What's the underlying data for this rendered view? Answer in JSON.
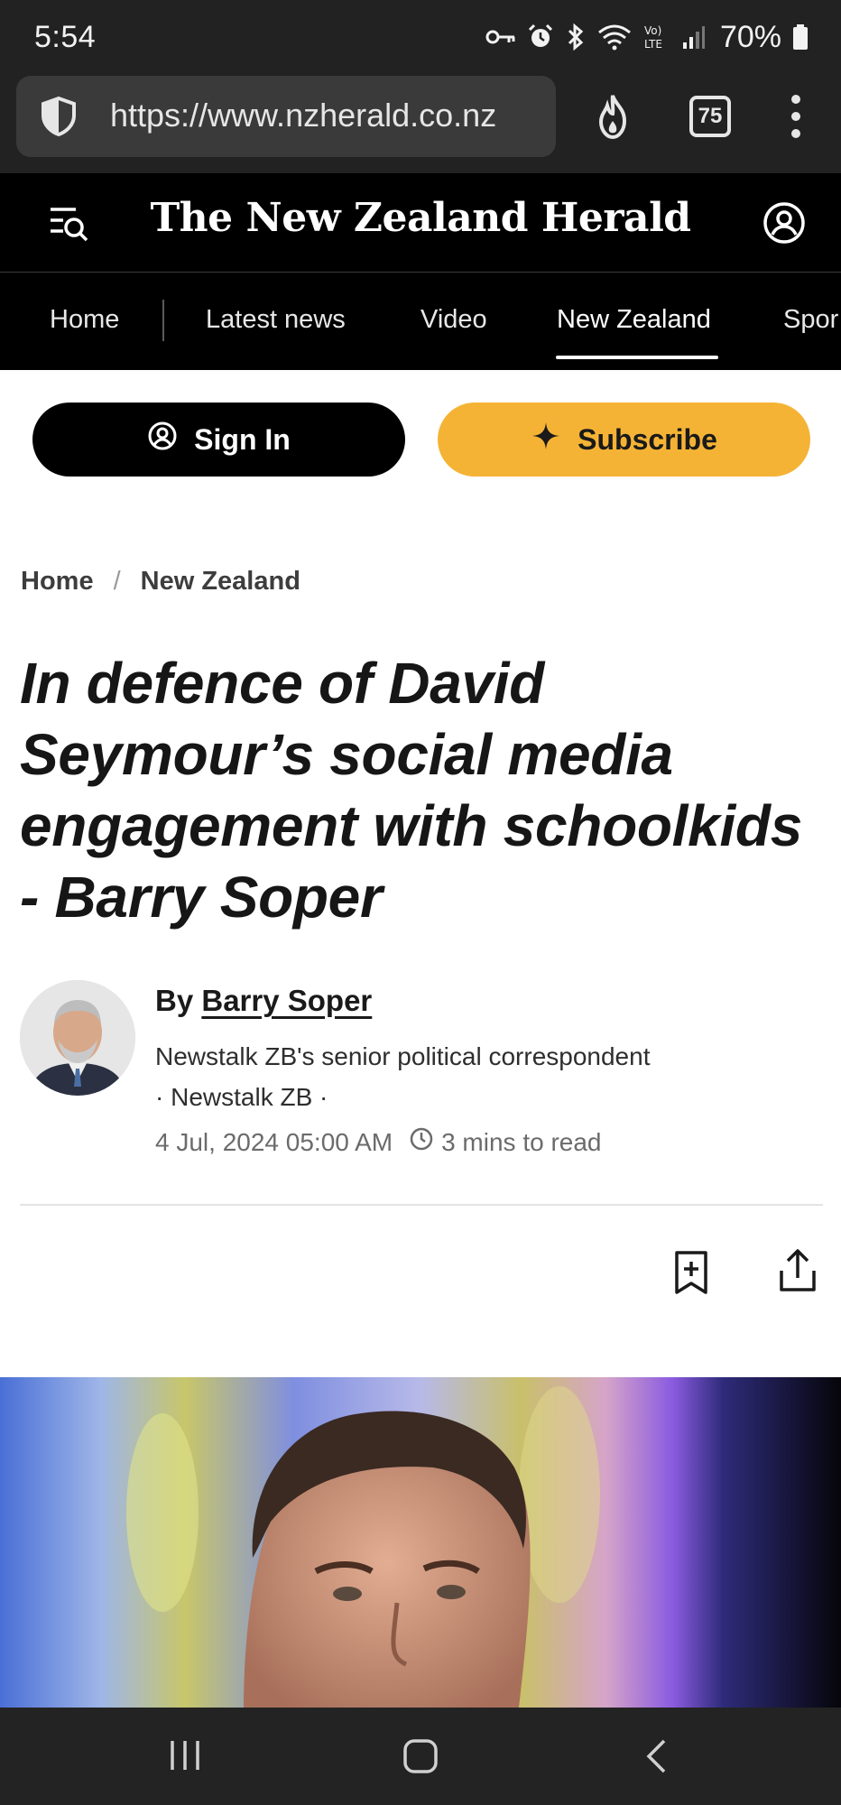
{
  "status_bar": {
    "time": "5:54",
    "battery": "70%"
  },
  "browser": {
    "url": "https://www.nzherald.co.nz",
    "tab_count": "75"
  },
  "site": {
    "masthead": "The New Zealand Herald"
  },
  "nav": {
    "items": [
      {
        "label": "Home"
      },
      {
        "label": "Latest news"
      },
      {
        "label": "Video"
      },
      {
        "label": "New Zealand"
      },
      {
        "label": "Spor"
      }
    ],
    "active": "New Zealand"
  },
  "auth": {
    "sign_in_label": "Sign In",
    "subscribe_label": "Subscribe"
  },
  "breadcrumb": {
    "items": [
      "Home",
      "New Zealand"
    ],
    "separator": "/"
  },
  "article": {
    "headline": "In defence of David Seymour’s social media engagement with schoolkids - Barry Soper",
    "by_prefix": "By",
    "author": "Barry Soper",
    "author_role": "Newstalk ZB's senior political correspondent · Newstalk ZB ·",
    "date": "4 Jul, 2024 05:00 AM",
    "read_time": "3 mins to read"
  },
  "colors": {
    "accent_subscribe": "#f5b335",
    "header_bg": "#000000",
    "status_bg": "#222222"
  },
  "icons": [
    "key-icon",
    "alarm-icon",
    "bluetooth-icon",
    "wifi-icon",
    "volte-icon",
    "signal-icon",
    "battery-icon",
    "shield-icon",
    "fire-icon",
    "tabs-icon",
    "kebab-menu-icon",
    "menu-search-icon",
    "account-icon",
    "user-circle-icon",
    "sparkle-icon",
    "clock-icon",
    "bookmark-add-icon",
    "share-icon",
    "recents-icon",
    "home-icon",
    "back-icon"
  ]
}
